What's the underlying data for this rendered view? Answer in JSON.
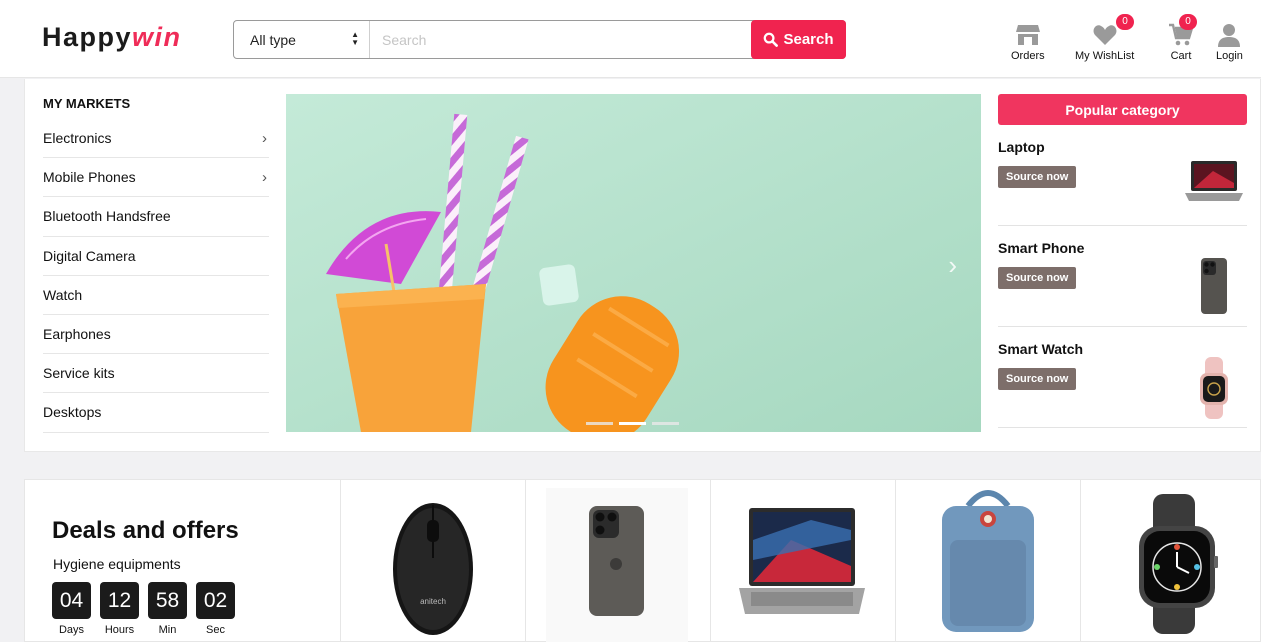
{
  "logo": {
    "part1": "Happy",
    "part2": "win"
  },
  "search": {
    "type_selected": "All type",
    "placeholder": "Search",
    "button_label": "Search"
  },
  "nav": {
    "orders": {
      "label": "Orders"
    },
    "wishlist": {
      "label": "My WishList",
      "count": "0"
    },
    "cart": {
      "label": "Cart",
      "count": "0"
    },
    "login": {
      "label": "Login"
    }
  },
  "markets": {
    "title": "MY MARKETS",
    "items": [
      {
        "label": "Electronics",
        "has_sub": true
      },
      {
        "label": "Mobile Phones",
        "has_sub": true
      },
      {
        "label": "Bluetooth Handsfree",
        "has_sub": false
      },
      {
        "label": "Digital Camera",
        "has_sub": false
      },
      {
        "label": "Watch",
        "has_sub": false
      },
      {
        "label": "Earphones",
        "has_sub": false
      },
      {
        "label": "Service kits",
        "has_sub": false
      },
      {
        "label": "Desktops",
        "has_sub": false
      }
    ]
  },
  "banner": {
    "next_icon": "chevron-right-icon",
    "slides": 3,
    "active_slide": 2
  },
  "popular": {
    "title": "Popular category",
    "items": [
      {
        "name": "Laptop",
        "button": "Source now"
      },
      {
        "name": "Smart Phone",
        "button": "Source now"
      },
      {
        "name": "Smart Watch",
        "button": "Source now"
      }
    ]
  },
  "deals": {
    "title": "Deals and offers",
    "subtitle": "Hygiene equipments",
    "timer": [
      {
        "value": "04",
        "label": "Days"
      },
      {
        "value": "12",
        "label": "Hours"
      },
      {
        "value": "58",
        "label": "Min"
      },
      {
        "value": "02",
        "label": "Sec"
      }
    ]
  },
  "colors": {
    "accent": "#f0234f",
    "source_button": "#7d6e6a",
    "banner_bg": "#b4e0cc"
  }
}
